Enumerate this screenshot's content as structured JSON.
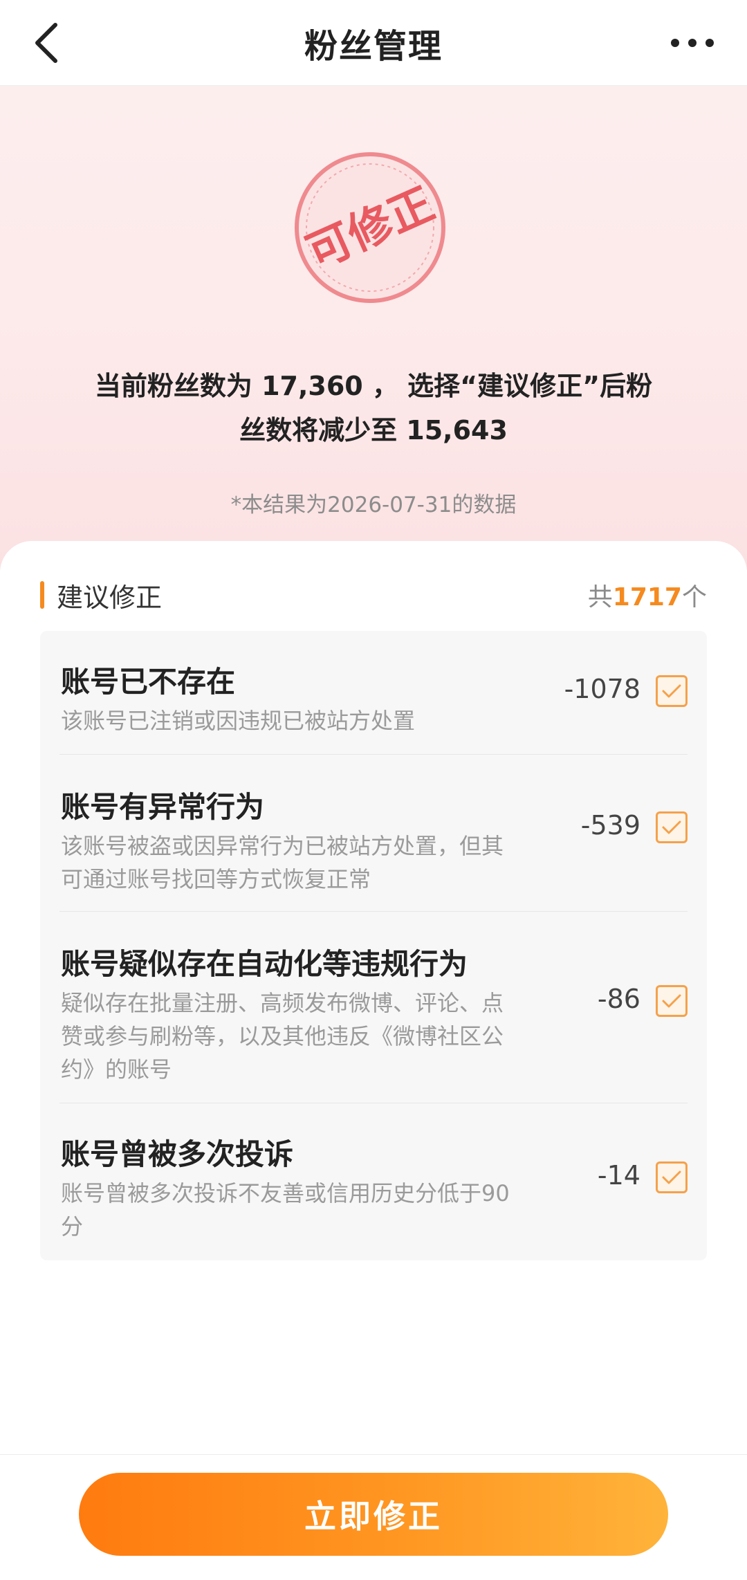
{
  "nav": {
    "title": "粉丝管理"
  },
  "hero": {
    "stamp_text": "可修正",
    "line1": "当前粉丝数为 17,360 ， 选择“建议修正”后粉",
    "line2": "丝数将减少至 15,643",
    "note": "*本结果为2026-07-31的数据"
  },
  "section": {
    "title": "建议修正",
    "count_prefix": "共",
    "count_value": "1717",
    "count_suffix": "个"
  },
  "items": [
    {
      "title": "账号已不存在",
      "desc": "该账号已注销或因违规已被站方处置",
      "value": "-1078",
      "checked": true
    },
    {
      "title": "账号有异常行为",
      "desc1": "该账号被盗或因异常行为已被站方处置，但其",
      "desc2": "可通过账号找回等方式恢复正常",
      "value": "-539",
      "checked": true
    },
    {
      "title": "账号疑似存在自动化等违规行为",
      "desc1": "疑似存在批量注册、高频发布微博、评论、点",
      "desc2": "赞或参与刷粉等，以及其他违反《微博社区公",
      "desc3": "约》的账号",
      "value": "-86",
      "checked": true
    },
    {
      "title": "账号曾被多次投诉",
      "desc1": "账号曾被多次投诉不友善或信用历史分低于90",
      "desc2": "分",
      "value": "-14",
      "checked": true
    }
  ],
  "footer": {
    "button_label": "立即修正"
  },
  "colors": {
    "accent": "#f58a1f",
    "stamp": "#e85a60"
  }
}
